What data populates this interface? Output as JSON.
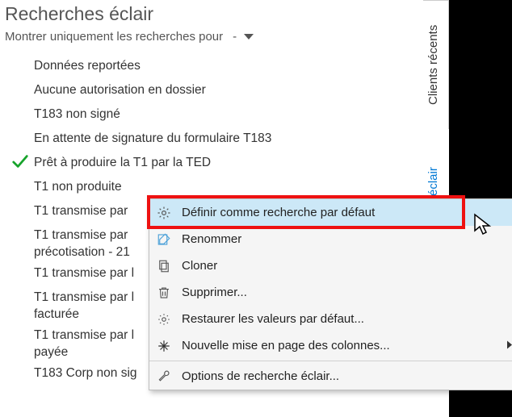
{
  "title": "Recherches éclair",
  "filter": {
    "label": "Montrer uniquement les recherches pour",
    "value": "-"
  },
  "list": [
    {
      "label": "Données reportées",
      "checked": false
    },
    {
      "label": "Aucune autorisation en dossier",
      "checked": false
    },
    {
      "label": "T183 non signé",
      "checked": false
    },
    {
      "label": "En attente de signature du formulaire T183",
      "checked": false
    },
    {
      "label": "Prêt à produire la T1 par la TED",
      "checked": true
    },
    {
      "label": "T1 non produite",
      "checked": false
    },
    {
      "label": "T1 transmise par ",
      "checked": false
    },
    {
      "label": "T1 transmise par  \nprécotisation - 21",
      "checked": false
    },
    {
      "label": "T1 transmise par l",
      "checked": false
    },
    {
      "label": "T1 transmise par l \nfacturée",
      "checked": false
    },
    {
      "label": "T1 transmise par l \npayée",
      "checked": false
    },
    {
      "label": "T183 Corp non sig",
      "checked": false
    }
  ],
  "side_tabs": {
    "recent": "Clients récents",
    "eclair": "éclair"
  },
  "menu": {
    "items": [
      {
        "icon": "gear-icon",
        "label": "Définir comme recherche par défaut",
        "hover": true
      },
      {
        "icon": "rename-icon",
        "label": "Renommer"
      },
      {
        "icon": "clone-icon",
        "label": "Cloner"
      },
      {
        "icon": "trash-icon",
        "label": "Supprimer..."
      },
      {
        "icon": "restore-icon",
        "label": "Restaurer les valeurs par défaut..."
      },
      {
        "icon": "columns-icon",
        "label": "Nouvelle mise en page des colonnes...",
        "submenu": true
      },
      {
        "sep": true
      },
      {
        "icon": "wrench-icon",
        "label": "Options de recherche éclair..."
      }
    ]
  },
  "colors": {
    "highlight": "#e11",
    "link": "#0078d4"
  }
}
